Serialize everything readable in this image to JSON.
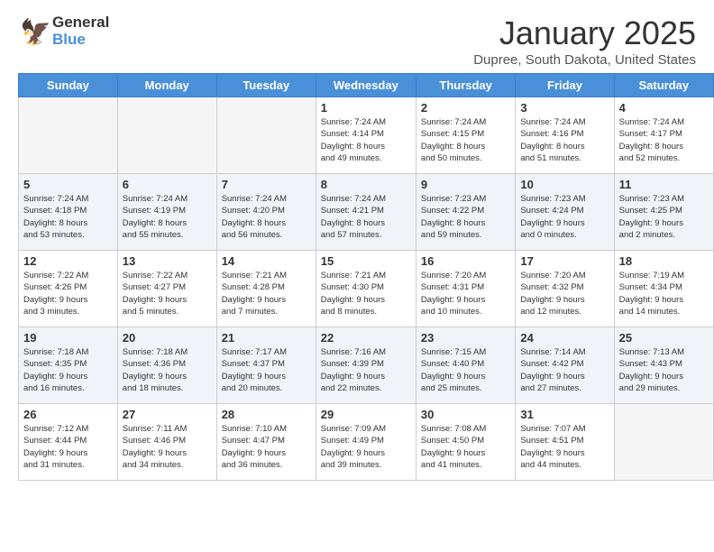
{
  "header": {
    "logo_general": "General",
    "logo_blue": "Blue",
    "month_title": "January 2025",
    "location": "Dupree, South Dakota, United States"
  },
  "weekdays": [
    "Sunday",
    "Monday",
    "Tuesday",
    "Wednesday",
    "Thursday",
    "Friday",
    "Saturday"
  ],
  "weeks": [
    [
      {
        "day": "",
        "info": ""
      },
      {
        "day": "",
        "info": ""
      },
      {
        "day": "",
        "info": ""
      },
      {
        "day": "1",
        "info": "Sunrise: 7:24 AM\nSunset: 4:14 PM\nDaylight: 8 hours\nand 49 minutes."
      },
      {
        "day": "2",
        "info": "Sunrise: 7:24 AM\nSunset: 4:15 PM\nDaylight: 8 hours\nand 50 minutes."
      },
      {
        "day": "3",
        "info": "Sunrise: 7:24 AM\nSunset: 4:16 PM\nDaylight: 8 hours\nand 51 minutes."
      },
      {
        "day": "4",
        "info": "Sunrise: 7:24 AM\nSunset: 4:17 PM\nDaylight: 8 hours\nand 52 minutes."
      }
    ],
    [
      {
        "day": "5",
        "info": "Sunrise: 7:24 AM\nSunset: 4:18 PM\nDaylight: 8 hours\nand 53 minutes."
      },
      {
        "day": "6",
        "info": "Sunrise: 7:24 AM\nSunset: 4:19 PM\nDaylight: 8 hours\nand 55 minutes."
      },
      {
        "day": "7",
        "info": "Sunrise: 7:24 AM\nSunset: 4:20 PM\nDaylight: 8 hours\nand 56 minutes."
      },
      {
        "day": "8",
        "info": "Sunrise: 7:24 AM\nSunset: 4:21 PM\nDaylight: 8 hours\nand 57 minutes."
      },
      {
        "day": "9",
        "info": "Sunrise: 7:23 AM\nSunset: 4:22 PM\nDaylight: 8 hours\nand 59 minutes."
      },
      {
        "day": "10",
        "info": "Sunrise: 7:23 AM\nSunset: 4:24 PM\nDaylight: 9 hours\nand 0 minutes."
      },
      {
        "day": "11",
        "info": "Sunrise: 7:23 AM\nSunset: 4:25 PM\nDaylight: 9 hours\nand 2 minutes."
      }
    ],
    [
      {
        "day": "12",
        "info": "Sunrise: 7:22 AM\nSunset: 4:26 PM\nDaylight: 9 hours\nand 3 minutes."
      },
      {
        "day": "13",
        "info": "Sunrise: 7:22 AM\nSunset: 4:27 PM\nDaylight: 9 hours\nand 5 minutes."
      },
      {
        "day": "14",
        "info": "Sunrise: 7:21 AM\nSunset: 4:28 PM\nDaylight: 9 hours\nand 7 minutes."
      },
      {
        "day": "15",
        "info": "Sunrise: 7:21 AM\nSunset: 4:30 PM\nDaylight: 9 hours\nand 8 minutes."
      },
      {
        "day": "16",
        "info": "Sunrise: 7:20 AM\nSunset: 4:31 PM\nDaylight: 9 hours\nand 10 minutes."
      },
      {
        "day": "17",
        "info": "Sunrise: 7:20 AM\nSunset: 4:32 PM\nDaylight: 9 hours\nand 12 minutes."
      },
      {
        "day": "18",
        "info": "Sunrise: 7:19 AM\nSunset: 4:34 PM\nDaylight: 9 hours\nand 14 minutes."
      }
    ],
    [
      {
        "day": "19",
        "info": "Sunrise: 7:18 AM\nSunset: 4:35 PM\nDaylight: 9 hours\nand 16 minutes."
      },
      {
        "day": "20",
        "info": "Sunrise: 7:18 AM\nSunset: 4:36 PM\nDaylight: 9 hours\nand 18 minutes."
      },
      {
        "day": "21",
        "info": "Sunrise: 7:17 AM\nSunset: 4:37 PM\nDaylight: 9 hours\nand 20 minutes."
      },
      {
        "day": "22",
        "info": "Sunrise: 7:16 AM\nSunset: 4:39 PM\nDaylight: 9 hours\nand 22 minutes."
      },
      {
        "day": "23",
        "info": "Sunrise: 7:15 AM\nSunset: 4:40 PM\nDaylight: 9 hours\nand 25 minutes."
      },
      {
        "day": "24",
        "info": "Sunrise: 7:14 AM\nSunset: 4:42 PM\nDaylight: 9 hours\nand 27 minutes."
      },
      {
        "day": "25",
        "info": "Sunrise: 7:13 AM\nSunset: 4:43 PM\nDaylight: 9 hours\nand 29 minutes."
      }
    ],
    [
      {
        "day": "26",
        "info": "Sunrise: 7:12 AM\nSunset: 4:44 PM\nDaylight: 9 hours\nand 31 minutes."
      },
      {
        "day": "27",
        "info": "Sunrise: 7:11 AM\nSunset: 4:46 PM\nDaylight: 9 hours\nand 34 minutes."
      },
      {
        "day": "28",
        "info": "Sunrise: 7:10 AM\nSunset: 4:47 PM\nDaylight: 9 hours\nand 36 minutes."
      },
      {
        "day": "29",
        "info": "Sunrise: 7:09 AM\nSunset: 4:49 PM\nDaylight: 9 hours\nand 39 minutes."
      },
      {
        "day": "30",
        "info": "Sunrise: 7:08 AM\nSunset: 4:50 PM\nDaylight: 9 hours\nand 41 minutes."
      },
      {
        "day": "31",
        "info": "Sunrise: 7:07 AM\nSunset: 4:51 PM\nDaylight: 9 hours\nand 44 minutes."
      },
      {
        "day": "",
        "info": ""
      }
    ]
  ]
}
